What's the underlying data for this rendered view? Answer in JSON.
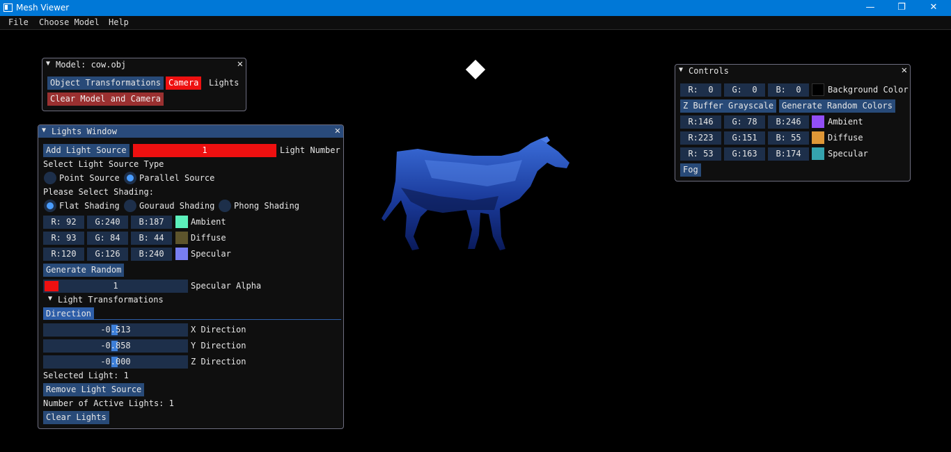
{
  "app": {
    "title": "Mesh Viewer",
    "minimize": "—",
    "maximize": "❐",
    "close": "✕"
  },
  "menu": [
    "File",
    "Choose Model",
    "Help"
  ],
  "model_window": {
    "title": "Model: cow.obj",
    "object_transformations": "Object Transformations",
    "camera": "Camera",
    "lights": "Lights",
    "clear": "Clear Model and Camera"
  },
  "lights_window": {
    "title": "Lights Window",
    "add_light": "Add Light Source",
    "light_number_value": "1",
    "light_number_label": "Light Number",
    "select_type_label": "Select Light Source Type",
    "point_source": "Point Source",
    "parallel_source": "Parallel Source",
    "shading_label": "Please Select Shading:",
    "flat": "Flat Shading",
    "gouraud": "Gouraud Shading",
    "phong": "Phong Shading",
    "rows": [
      {
        "r": "R: 92",
        "g": "G:240",
        "b": "B:187",
        "color": "#5cf0bb",
        "label": "Ambient"
      },
      {
        "r": "R: 93",
        "g": "G: 84",
        "b": "B: 44",
        "color": "#5d542c",
        "label": "Diffuse"
      },
      {
        "r": "R:120",
        "g": "G:126",
        "b": "B:240",
        "color": "#787ef0",
        "label": "Specular"
      }
    ],
    "generate_random": "Generate Random",
    "specular_alpha_value": "1",
    "specular_alpha_label": "Specular Alpha",
    "light_transformations": "Light Transformations",
    "direction_tab": "Direction",
    "directions": [
      {
        "value": "-0.513",
        "label": "X Direction",
        "level": 0.49
      },
      {
        "value": "-0.858",
        "label": "Y Direction",
        "level": 0.49
      },
      {
        "value": "-0.000",
        "label": "Z Direction",
        "level": 0.49
      }
    ],
    "selected_light": "Selected Light: 1",
    "remove_light": "Remove Light Source",
    "active_lights": "Number of Active Lights: 1",
    "clear_lights": "Clear Lights"
  },
  "controls": {
    "title": "Controls",
    "bg": {
      "r": "R:  0",
      "g": "G:  0",
      "b": "B:  0",
      "color": "#000000",
      "label": "Background Color"
    },
    "zbuffer": "Z Buffer Grayscale",
    "random_colors": "Generate Random Colors",
    "rows": [
      {
        "r": "R:146",
        "g": "G: 78",
        "b": "B:246",
        "color": "#924ef6",
        "label": "Ambient"
      },
      {
        "r": "R:223",
        "g": "G:151",
        "b": "B: 55",
        "color": "#df9737",
        "label": "Diffuse"
      },
      {
        "r": "R: 53",
        "g": "G:163",
        "b": "B:174",
        "color": "#35a3ae",
        "label": "Specular"
      }
    ],
    "fog": "Fog"
  }
}
